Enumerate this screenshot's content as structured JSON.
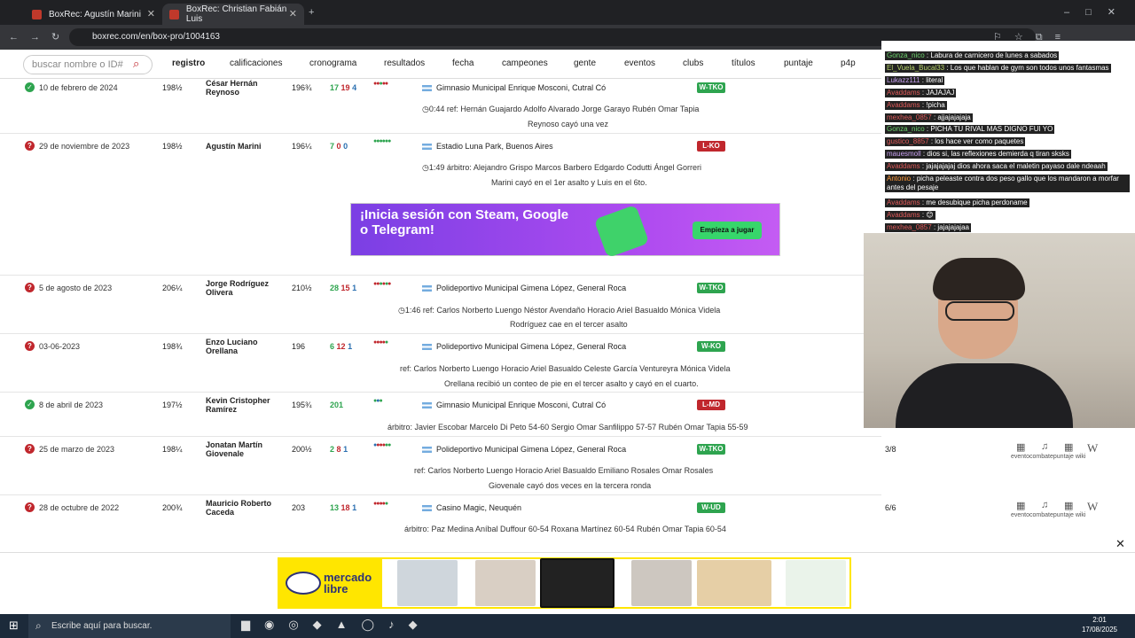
{
  "browser": {
    "tabs": [
      {
        "title": "BoxRec: Agustín Marini"
      },
      {
        "title": "BoxRec: Christian Fabián Luis"
      }
    ],
    "url": "boxrec.com/en/box-pro/1004163"
  },
  "nav": {
    "search_placeholder": "buscar nombre o ID#",
    "items": [
      "registro",
      "calificaciones",
      "cronograma",
      "resultados",
      "fecha",
      "campeones",
      "gente",
      "eventos",
      "clubs",
      "títulos",
      "puntaje",
      "p4p"
    ]
  },
  "fights": [
    {
      "date": "10 de febrero de 2024",
      "weight": "198½",
      "opponent": "César Hernán Reynoso",
      "opp_weight": "196¾",
      "w": "17",
      "l": "19",
      "d": "4",
      "venue": "Gimnasio Municipal Enrique Mosconi, Cutral Có",
      "result": "W-TKO",
      "officials": "0:44   ref: Hernán Guajardo   Adolfo Alvarado   Jorge Garayo   Rubén Omar Tapia",
      "note": "Reynoso cayó una vez"
    },
    {
      "date": "29 de noviembre de 2023",
      "weight": "198½",
      "opponent": "Agustín Marini",
      "opp_weight": "196¼",
      "w": "7",
      "l": "0",
      "d": "0",
      "venue": "Estadio Luna Park, Buenos Aires",
      "result": "L-KO",
      "officials": "1:49   árbitro: Alejandro Grispo   Marcos Barbero   Edgardo Codutti   Ángel Gorreri",
      "note": "Marini cayó en el 1er asalto y Luis en el 6to."
    },
    {
      "date": "5 de agosto de 2023",
      "weight": "206¼",
      "opponent": "Jorge Rodríguez Olivera",
      "opp_weight": "210½",
      "w": "28",
      "l": "15",
      "d": "1",
      "venue": "Polideportivo Municipal Gimena López, General Roca",
      "result": "W-TKO",
      "officials": "1:46   ref: Carlos Norberto Luengo   Néstor Avendaño   Horacio Ariel Basualdo   Mónica Videla",
      "note": "Rodríguez cae en el tercer asalto"
    },
    {
      "date": "03-06-2023",
      "weight": "198¾",
      "opponent": "Enzo Luciano Orellana",
      "opp_weight": "196",
      "w": "6",
      "l": "12",
      "d": "1",
      "venue": "Polideportivo Municipal Gimena López, General Roca",
      "result": "W-KO",
      "officials": "ref: Carlos Norberto Luengo   Horacio Ariel Basualdo   Celeste García Ventureyra   Mónica Videla",
      "note": "Orellana recibió un conteo de pie en el tercer asalto y cayó en el cuarto."
    },
    {
      "date": "8 de abril de 2023",
      "weight": "197½",
      "opponent": "Kevin Cristopher Ramírez",
      "opp_weight": "195¾",
      "w": "201",
      "l": "",
      "d": "",
      "venue": "Gimnasio Municipal Enrique Mosconi, Cutral Có",
      "result": "L-MD",
      "officials": "árbitro: Javier Escobar   Marcelo Di Peto 54-60   Sergio Omar Sanfilippo 57-57   Rubén Omar Tapia 55-59",
      "note": ""
    },
    {
      "date": "25 de marzo de 2023",
      "weight": "198¼",
      "opponent": "Jonatan Martín Giovenale",
      "opp_weight": "200½",
      "w": "2",
      "l": "8",
      "d": "1",
      "venue": "Polideportivo Municipal Gimena López, General Roca",
      "result": "W-TKO",
      "officials": "ref: Carlos Norberto Luengo   Horacio Ariel Basualdo   Emiliano Rosales   Omar Rosales",
      "note": "Giovenale cayó dos veces en la tercera ronda",
      "rounds": "3/8"
    },
    {
      "date": "28 de octubre de 2022",
      "weight": "200¾",
      "opponent": "Mauricio Roberto Caceda",
      "opp_weight": "203",
      "w": "13",
      "l": "18",
      "d": "1",
      "venue": "Casino Magic, Neuquén",
      "result": "W-UD",
      "officials": "árbitro: Paz Medina   Aníbal Duffour 60-54   Roxana Martínez 60-54   Rubén Omar Tapia 60-54",
      "note": "",
      "rounds": "6/6"
    }
  ],
  "ad": {
    "headline": "¡Inicia sesión con Steam, Google o Telegram!",
    "cta": "Empieza a jugar"
  },
  "icons": {
    "evento": "evento",
    "combate": "combate",
    "puntaje": "puntaje",
    "wiki": "wiki"
  },
  "chat": [
    {
      "user": "Gonza_nico",
      "msg": "Labura de carnicero de lunes a sabados"
    },
    {
      "user": "El_Vuela_Bucal33",
      "msg": "Los que hablan de gym son todos unos fantasmas"
    },
    {
      "user": "Lukazz111",
      "msg": "literal"
    },
    {
      "user": "Avaddams",
      "msg": "JAJAJAJ"
    },
    {
      "user": "Avaddams",
      "msg": "!picha"
    },
    {
      "user": "mexhea_0857",
      "msg": "ajjajajajaja"
    },
    {
      "user": "Gonza_nico",
      "msg": "PICHA TU RIVAL MAS DIGNO FUI YO"
    },
    {
      "user": "gustico_8857",
      "msg": "los hace ver como paquetes"
    },
    {
      "user": "mauesmoll",
      "msg": "dios si, las reflexiones demierda q tiran sksks"
    },
    {
      "user": "Avaddams",
      "msg": "jajajajajaj dios ahora saca el maletin payaso dale ndeaah"
    },
    {
      "user": "Antonio",
      "msg": "picha peleaste contra dos peso gallo que los mandaron a morfar antes del pesaje"
    },
    {
      "user": "Avaddams",
      "msg": "me desubique picha perdoname"
    },
    {
      "user": "Avaddams",
      "msg": "😊"
    },
    {
      "user": "mexhea_0857",
      "msg": "jajajajajaa"
    }
  ],
  "bottom_ad": {
    "brand": "mercado libre"
  },
  "taskbar": {
    "search": "Escribe aquí para buscar.",
    "time": "2:01",
    "date": "17/08/2025"
  }
}
